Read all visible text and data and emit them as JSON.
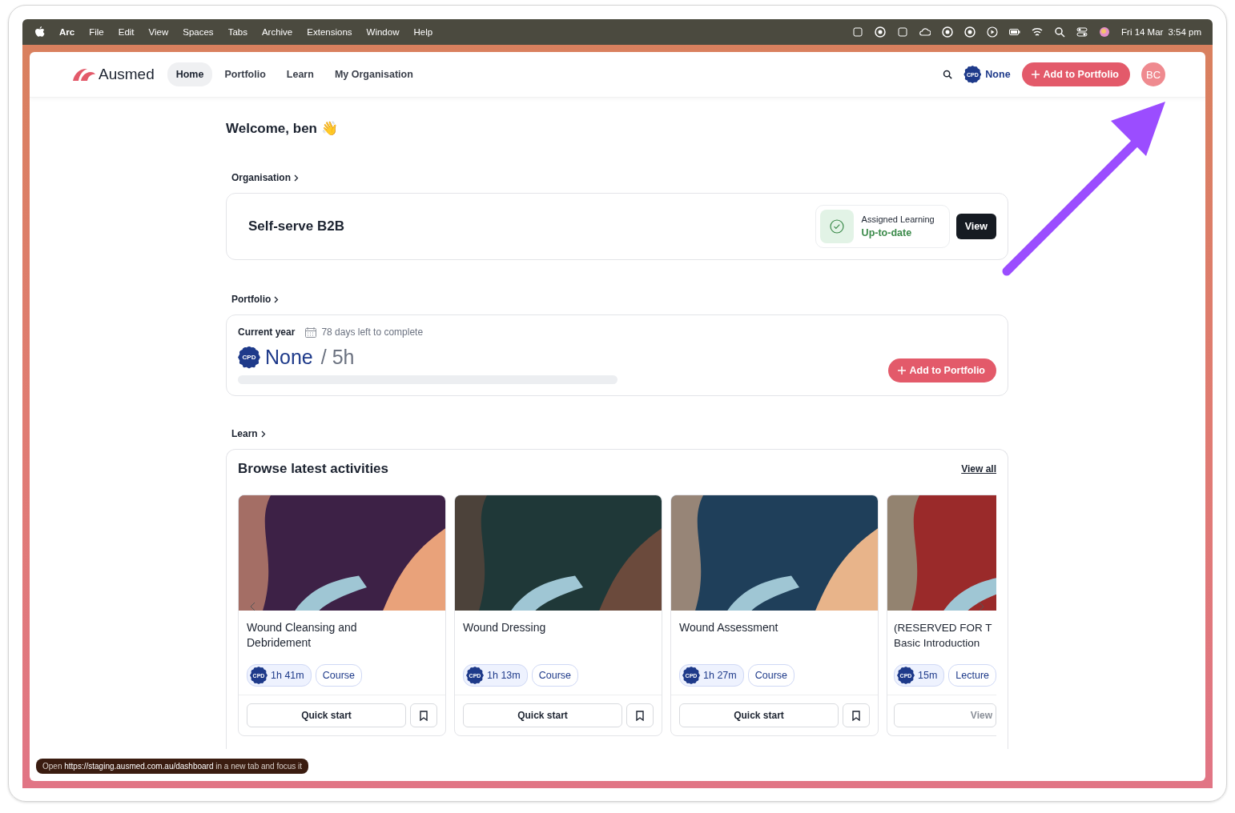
{
  "menu_bar": {
    "app": "Arc",
    "items": [
      "File",
      "Edit",
      "View",
      "Spaces",
      "Tabs",
      "Archive",
      "Extensions",
      "Window",
      "Help"
    ],
    "date": "Fri 14 Mar",
    "time": "3:54 pm"
  },
  "nav": {
    "logo": "Ausmed",
    "tabs": [
      {
        "label": "Home",
        "selected": true
      },
      {
        "label": "Portfolio",
        "selected": false
      },
      {
        "label": "Learn",
        "selected": false
      },
      {
        "label": "My Organisation",
        "selected": false
      }
    ],
    "cpd_badge": "CPD",
    "cpd_value": "None",
    "add_button": "Add to Portfolio",
    "avatar": "BC"
  },
  "welcome": "Welcome, ben 👋",
  "organisation": {
    "heading": "Organisation",
    "name": "Self-serve B2B",
    "status_label": "Assigned Learning",
    "status_value": "Up-to-date",
    "view_button": "View"
  },
  "portfolio": {
    "heading": "Portfolio",
    "period": "Current year",
    "days_left": "78 days left to complete",
    "cpd_badge": "CPD",
    "value": "None",
    "target": "/ 5h",
    "level": 0,
    "add_button": "Add to Portfolio"
  },
  "learn": {
    "heading": "Learn",
    "title": "Browse latest activities",
    "view_all": "View all",
    "cards": [
      {
        "title": "Wound Cleansing and\nDebridement",
        "cpd_badge": "CPD",
        "duration": "1h 41m",
        "type": "Course",
        "action": "Quick start",
        "bookmark": true
      },
      {
        "title": "Wound Dressing",
        "cpd_badge": "CPD",
        "duration": "1h 13m",
        "type": "Course",
        "action": "Quick start",
        "bookmark": true
      },
      {
        "title": "Wound Assessment",
        "cpd_badge": "CPD",
        "duration": "1h 27m",
        "type": "Course",
        "action": "Quick start",
        "bookmark": true
      },
      {
        "title": "(RESERVED FOR T\nBasic Introduction",
        "cpd_badge": "CPD",
        "duration": "15m",
        "type": "Lecture",
        "action": "View",
        "bookmark": false
      }
    ]
  },
  "status_tooltip": {
    "prefix": "Open",
    "url": "https://staging.ausmed.com.au/dashboard",
    "suffix": "in a new tab and focus it"
  }
}
